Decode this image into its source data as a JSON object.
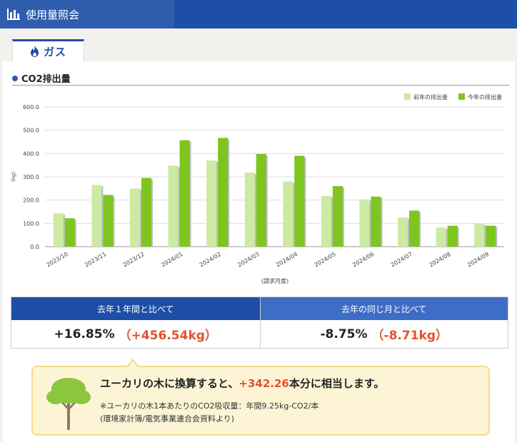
{
  "header": {
    "title": "使用量照会",
    "icon": "bar-chart-icon"
  },
  "tab": {
    "label": "ガス",
    "icon": "flame-icon"
  },
  "section": {
    "title": "CO2排出量"
  },
  "colors": {
    "prev": "#cdeaa3",
    "curr": "#7ec51f",
    "header": "#1e4fa7",
    "accent": "#e2522d"
  },
  "chart_data": {
    "type": "bar",
    "categories": [
      "2023/10",
      "2023/11",
      "2023/12",
      "2024/01",
      "2024/02",
      "2024/03",
      "2024/04",
      "2024/05",
      "2024/06",
      "2024/07",
      "2024/08",
      "2024/09"
    ],
    "series": [
      {
        "name": "前年の排出量",
        "values": [
          143,
          265,
          250,
          348,
          370,
          318,
          280,
          218,
          203,
          125,
          82,
          98
        ]
      },
      {
        "name": "今年の排出量",
        "values": [
          122,
          222,
          295,
          457,
          467,
          398,
          390,
          260,
          215,
          155,
          90,
          90
        ]
      }
    ],
    "ylabel": "(kg)",
    "xlabel": "(請求月度)",
    "ylim": [
      0,
      600
    ],
    "yticks": [
      "0.0",
      "100.0",
      "200.0",
      "300.0",
      "400.0",
      "500.0",
      "600.0"
    ],
    "legend": "top-right",
    "grid": true
  },
  "compare": {
    "year": {
      "label": "去年１年間と比べて",
      "value": "+16.85%",
      "diff": "（+456.54kg）"
    },
    "month": {
      "label": "去年の同じ月と比べて",
      "value": "-8.75%",
      "diff": "（-8.71kg）"
    }
  },
  "tree_info": {
    "prefix": "ユーカリの木に換算すると、",
    "count": "+342.26",
    "suffix": "本分に相当します。",
    "note1": "※ユーカリの木1本あたりのCO2吸収量：年間9.25kg-CO2/本",
    "note2": "(環境家計簿/電気事業連合会資料より)",
    "icon": "tree-icon"
  }
}
